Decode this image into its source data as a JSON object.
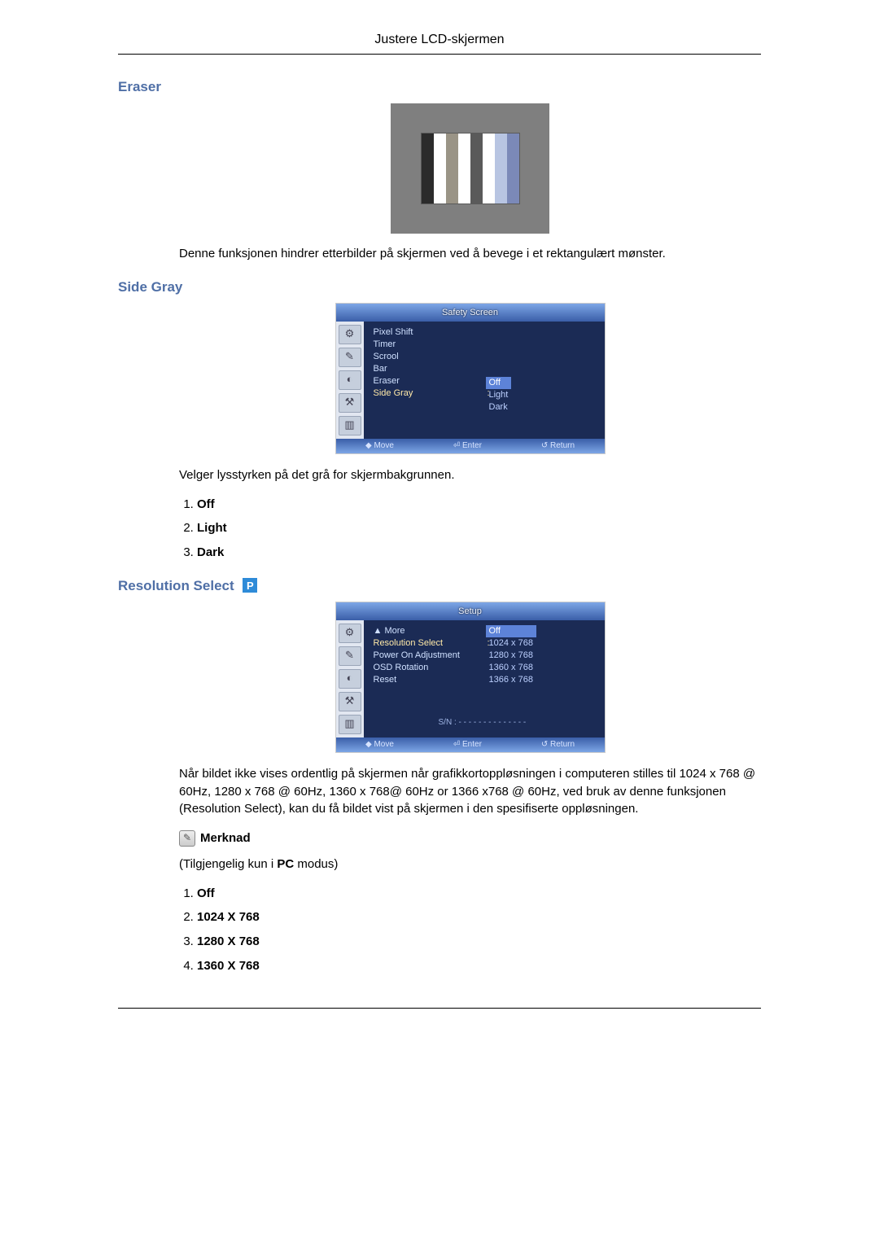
{
  "header": {
    "title": "Justere LCD-skjermen"
  },
  "eraser": {
    "heading": "Eraser",
    "desc": "Denne funksjonen hindrer etterbilder på skjermen ved å bevege i et rektangulært mønster.",
    "bar_colors": [
      "#2b2b2b",
      "#ffffff",
      "#9a9486",
      "#ffffff",
      "#5a5a5a",
      "#ffffff",
      "#b8c5e2",
      "#7b89b8"
    ]
  },
  "sidegray": {
    "heading": "Side Gray",
    "osd_title": "Safety Screen",
    "menu_items": [
      "Pixel Shift",
      "Timer",
      "Scrool",
      "Bar",
      "Eraser",
      "Side Gray"
    ],
    "highlight_index": 5,
    "options": [
      "Off",
      "Light",
      "Dark"
    ],
    "selected_option_index": 0,
    "footer": {
      "move": "Move",
      "enter": "Enter",
      "return": "Return"
    },
    "desc": "Velger lysstyrken på det grå for skjermbakgrunnen.",
    "list": [
      "Off",
      "Light",
      "Dark"
    ]
  },
  "resolution": {
    "heading": "Resolution Select",
    "badge": "P",
    "osd_title": "Setup",
    "menu_items": [
      "▲  More",
      "Resolution Select",
      "Power On Adjustment",
      "OSD Rotation",
      "Reset"
    ],
    "highlight_index": 1,
    "options": [
      "Off",
      "1024 x 768",
      "1280 x 768",
      "1360 x 768",
      "1366 x 768"
    ],
    "selected_option_index": 0,
    "sn": "S/N : - - - - - - - - - - - - - -",
    "footer": {
      "move": "Move",
      "enter": "Enter",
      "return": "Return"
    },
    "desc": "Når bildet ikke vises ordentlig på skjermen når grafikkortoppløsningen i computeren stilles til 1024 x 768 @ 60Hz, 1280 x 768 @ 60Hz, 1360 x 768@ 60Hz or 1366 x768 @ 60Hz, ved bruk av denne funksjonen (Resolution Select), kan du få bildet vist på skjermen i den spesifiserte oppløsningen.",
    "note_label": "Merknad",
    "note_text_pre": "(Tilgjengelig kun i ",
    "note_text_bold": "PC",
    "note_text_post": " modus)",
    "list": [
      "Off",
      "1024 X 768",
      "1280 X 768",
      "1360 X 768"
    ]
  },
  "osd_icons": [
    "⚙",
    "✎",
    "◐",
    "⚒",
    "▥"
  ]
}
